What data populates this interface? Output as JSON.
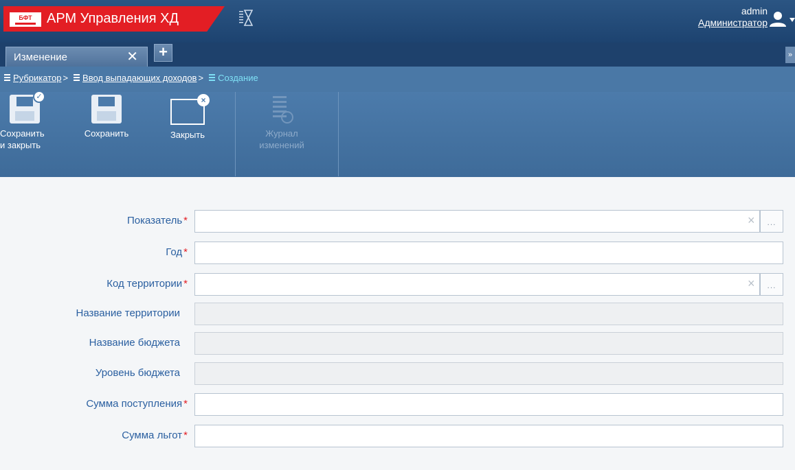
{
  "header": {
    "logo_text": "БФТ",
    "app_title": "АРМ Управления ХД",
    "user_name": "admin",
    "user_role": "Администратор"
  },
  "tabs": {
    "items": [
      {
        "label": "Изменение"
      }
    ],
    "close_glyph": "✕",
    "add_glyph": "+",
    "more_glyph": "»"
  },
  "breadcrumb": {
    "items": [
      {
        "label": "Рубрикатор",
        "link": true
      },
      {
        "label": "Ввод выпадающих доходов",
        "link": true
      },
      {
        "label": "Создание",
        "link": false
      }
    ],
    "separator": ">"
  },
  "toolbar": {
    "save_close_line1": "Сохранить",
    "save_close_line2": "и закрыть",
    "save_label": "Сохранить",
    "close_label": "Закрыть",
    "journal_line1": "Журнал",
    "journal_line2": "изменений"
  },
  "form": {
    "fields": [
      {
        "label": "Показатель",
        "required": true,
        "readonly": false,
        "picker": true,
        "value": ""
      },
      {
        "label": "Год",
        "required": true,
        "readonly": false,
        "picker": false,
        "value": ""
      },
      {
        "label": "Код территории",
        "required": true,
        "readonly": false,
        "picker": true,
        "value": ""
      },
      {
        "label": "Название территории",
        "required": false,
        "readonly": true,
        "picker": false,
        "value": ""
      },
      {
        "label": "Название бюджета",
        "required": false,
        "readonly": true,
        "picker": false,
        "value": ""
      },
      {
        "label": "Уровень бюджета",
        "required": false,
        "readonly": true,
        "picker": false,
        "value": ""
      },
      {
        "label": "Сумма поступления",
        "required": true,
        "readonly": false,
        "picker": false,
        "value": ""
      },
      {
        "label": "Сумма льгот",
        "required": true,
        "readonly": false,
        "picker": false,
        "value": ""
      }
    ],
    "required_mark": "*",
    "clear_glyph": "×",
    "picker_glyph": "..."
  },
  "colors": {
    "brand_red": "#e31e24",
    "header_blue": "#1d4370",
    "toolbar_blue": "#4c7bab",
    "label_blue": "#2a5fa0",
    "breadcrumb_current": "#7ee0f5"
  }
}
